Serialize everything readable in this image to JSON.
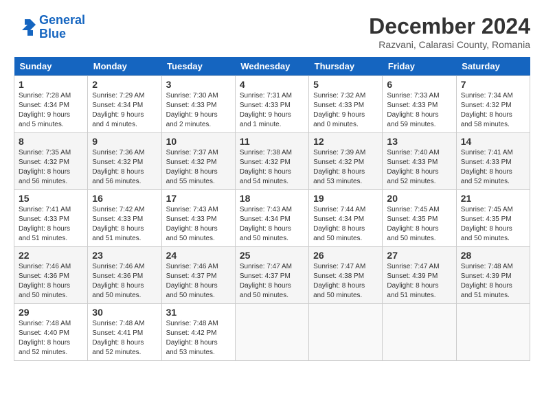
{
  "header": {
    "logo_line1": "General",
    "logo_line2": "Blue",
    "month_title": "December 2024",
    "location": "Razvani, Calarasi County, Romania"
  },
  "calendar": {
    "days_of_week": [
      "Sunday",
      "Monday",
      "Tuesday",
      "Wednesday",
      "Thursday",
      "Friday",
      "Saturday"
    ],
    "weeks": [
      [
        {
          "day": "",
          "info": ""
        },
        {
          "day": "2",
          "info": "Sunrise: 7:29 AM\nSunset: 4:34 PM\nDaylight: 9 hours and 4 minutes."
        },
        {
          "day": "3",
          "info": "Sunrise: 7:30 AM\nSunset: 4:33 PM\nDaylight: 9 hours and 2 minutes."
        },
        {
          "day": "4",
          "info": "Sunrise: 7:31 AM\nSunset: 4:33 PM\nDaylight: 9 hours and 1 minute."
        },
        {
          "day": "5",
          "info": "Sunrise: 7:32 AM\nSunset: 4:33 PM\nDaylight: 9 hours and 0 minutes."
        },
        {
          "day": "6",
          "info": "Sunrise: 7:33 AM\nSunset: 4:33 PM\nDaylight: 8 hours and 59 minutes."
        },
        {
          "day": "7",
          "info": "Sunrise: 7:34 AM\nSunset: 4:32 PM\nDaylight: 8 hours and 58 minutes."
        }
      ],
      [
        {
          "day": "8",
          "info": "Sunrise: 7:35 AM\nSunset: 4:32 PM\nDaylight: 8 hours and 56 minutes."
        },
        {
          "day": "9",
          "info": "Sunrise: 7:36 AM\nSunset: 4:32 PM\nDaylight: 8 hours and 56 minutes."
        },
        {
          "day": "10",
          "info": "Sunrise: 7:37 AM\nSunset: 4:32 PM\nDaylight: 8 hours and 55 minutes."
        },
        {
          "day": "11",
          "info": "Sunrise: 7:38 AM\nSunset: 4:32 PM\nDaylight: 8 hours and 54 minutes."
        },
        {
          "day": "12",
          "info": "Sunrise: 7:39 AM\nSunset: 4:32 PM\nDaylight: 8 hours and 53 minutes."
        },
        {
          "day": "13",
          "info": "Sunrise: 7:40 AM\nSunset: 4:33 PM\nDaylight: 8 hours and 52 minutes."
        },
        {
          "day": "14",
          "info": "Sunrise: 7:41 AM\nSunset: 4:33 PM\nDaylight: 8 hours and 52 minutes."
        }
      ],
      [
        {
          "day": "15",
          "info": "Sunrise: 7:41 AM\nSunset: 4:33 PM\nDaylight: 8 hours and 51 minutes."
        },
        {
          "day": "16",
          "info": "Sunrise: 7:42 AM\nSunset: 4:33 PM\nDaylight: 8 hours and 51 minutes."
        },
        {
          "day": "17",
          "info": "Sunrise: 7:43 AM\nSunset: 4:33 PM\nDaylight: 8 hours and 50 minutes."
        },
        {
          "day": "18",
          "info": "Sunrise: 7:43 AM\nSunset: 4:34 PM\nDaylight: 8 hours and 50 minutes."
        },
        {
          "day": "19",
          "info": "Sunrise: 7:44 AM\nSunset: 4:34 PM\nDaylight: 8 hours and 50 minutes."
        },
        {
          "day": "20",
          "info": "Sunrise: 7:45 AM\nSunset: 4:35 PM\nDaylight: 8 hours and 50 minutes."
        },
        {
          "day": "21",
          "info": "Sunrise: 7:45 AM\nSunset: 4:35 PM\nDaylight: 8 hours and 50 minutes."
        }
      ],
      [
        {
          "day": "22",
          "info": "Sunrise: 7:46 AM\nSunset: 4:36 PM\nDaylight: 8 hours and 50 minutes."
        },
        {
          "day": "23",
          "info": "Sunrise: 7:46 AM\nSunset: 4:36 PM\nDaylight: 8 hours and 50 minutes."
        },
        {
          "day": "24",
          "info": "Sunrise: 7:46 AM\nSunset: 4:37 PM\nDaylight: 8 hours and 50 minutes."
        },
        {
          "day": "25",
          "info": "Sunrise: 7:47 AM\nSunset: 4:37 PM\nDaylight: 8 hours and 50 minutes."
        },
        {
          "day": "26",
          "info": "Sunrise: 7:47 AM\nSunset: 4:38 PM\nDaylight: 8 hours and 50 minutes."
        },
        {
          "day": "27",
          "info": "Sunrise: 7:47 AM\nSunset: 4:39 PM\nDaylight: 8 hours and 51 minutes."
        },
        {
          "day": "28",
          "info": "Sunrise: 7:48 AM\nSunset: 4:39 PM\nDaylight: 8 hours and 51 minutes."
        }
      ],
      [
        {
          "day": "29",
          "info": "Sunrise: 7:48 AM\nSunset: 4:40 PM\nDaylight: 8 hours and 52 minutes."
        },
        {
          "day": "30",
          "info": "Sunrise: 7:48 AM\nSunset: 4:41 PM\nDaylight: 8 hours and 52 minutes."
        },
        {
          "day": "31",
          "info": "Sunrise: 7:48 AM\nSunset: 4:42 PM\nDaylight: 8 hours and 53 minutes."
        },
        {
          "day": "",
          "info": ""
        },
        {
          "day": "",
          "info": ""
        },
        {
          "day": "",
          "info": ""
        },
        {
          "day": "",
          "info": ""
        }
      ]
    ],
    "week0_sunday": {
      "day": "1",
      "info": "Sunrise: 7:28 AM\nSunset: 4:34 PM\nDaylight: 9 hours and 5 minutes."
    }
  }
}
